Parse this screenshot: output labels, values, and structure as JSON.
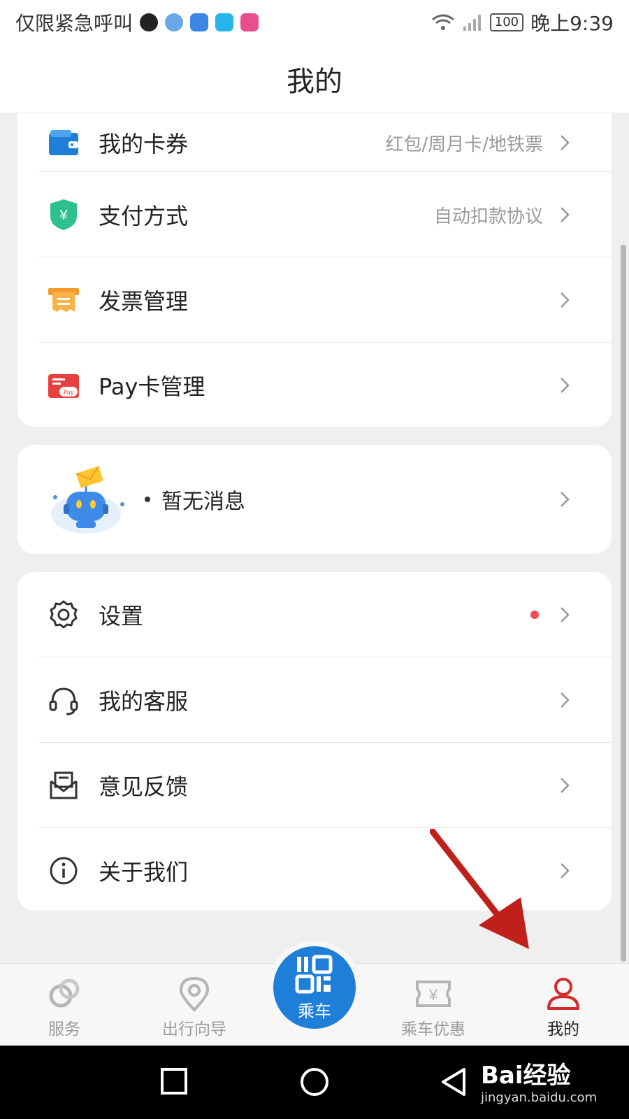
{
  "status_bar": {
    "carrier_text": "仅限紧急呼叫",
    "battery": "100",
    "time": "晚上9:39"
  },
  "header": {
    "title": "我的"
  },
  "section1": {
    "items": [
      {
        "label": "我的卡券",
        "sub": "红包/周月卡/地铁票",
        "icon": "wallet-icon"
      },
      {
        "label": "支付方式",
        "sub": "自动扣款协议",
        "icon": "yuan-shield-icon"
      },
      {
        "label": "发票管理",
        "sub": "",
        "icon": "invoice-icon"
      },
      {
        "label": "Pay卡管理",
        "sub": "",
        "icon": "pay-card-icon"
      }
    ]
  },
  "message": {
    "text": "暂无消息",
    "icon": "robot-mail-icon"
  },
  "section3": {
    "items": [
      {
        "label": "设置",
        "icon": "gear-icon",
        "badge": "red-dot"
      },
      {
        "label": "我的客服",
        "icon": "headset-icon"
      },
      {
        "label": "意见反馈",
        "icon": "feedback-icon"
      },
      {
        "label": "关于我们",
        "icon": "info-icon"
      }
    ]
  },
  "tabbar": {
    "tabs": [
      {
        "label": "服务",
        "icon": "service-icon"
      },
      {
        "label": "出行向导",
        "icon": "location-pin-icon"
      },
      {
        "label": "乘车",
        "icon": "qr-code-icon"
      },
      {
        "label": "乘车优惠",
        "icon": "ticket-yuan-icon"
      },
      {
        "label": "我的",
        "icon": "person-icon"
      }
    ],
    "active": "我的"
  },
  "watermark": {
    "brand": "Bai经验",
    "url": "jingyan.baidu.com"
  },
  "colors": {
    "accent": "#1e7ed8",
    "active_tab": "#d42a2a",
    "badge": "#f04b55",
    "arrow": "#c0201a"
  }
}
